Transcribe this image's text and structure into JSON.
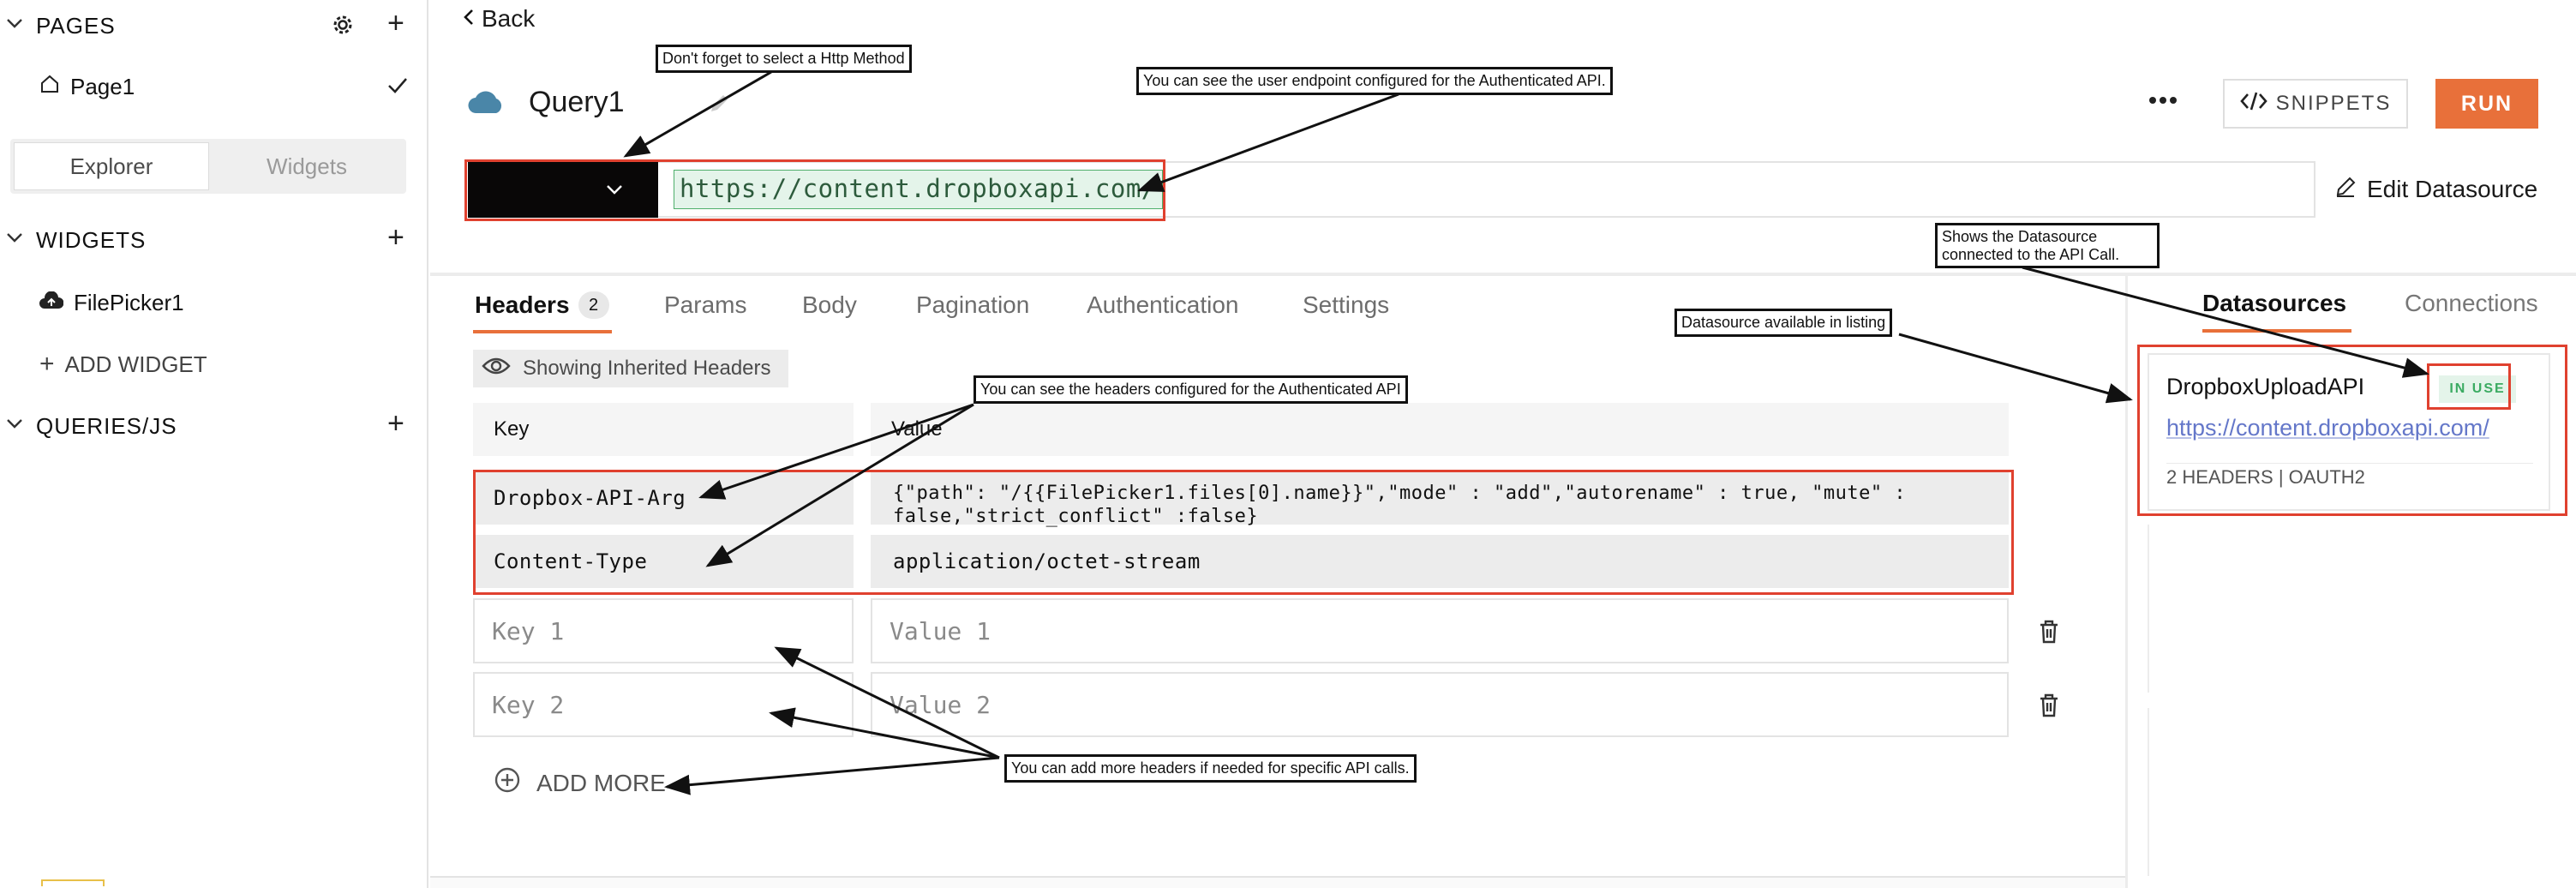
{
  "sidebar": {
    "pages_title": "PAGES",
    "page1": "Page1",
    "toggle_explorer": "Explorer",
    "toggle_widgets": "Widgets",
    "widgets_title": "WIDGETS",
    "widget_item": "FilePicker1",
    "add_widget": "ADD WIDGET",
    "queries_title": "QUERIES/JS"
  },
  "header": {
    "back": "Back",
    "query_name": "Query1",
    "snippets": "SNIPPETS",
    "run": "RUN",
    "edit_datasource": "Edit Datasource"
  },
  "url": {
    "value": "https://content.dropboxapi.com/"
  },
  "tabs": {
    "headers": "Headers",
    "headers_count": "2",
    "params": "Params",
    "body": "Body",
    "pagination": "Pagination",
    "authentication": "Authentication",
    "settings": "Settings"
  },
  "headers_panel": {
    "showing_inherited": "Showing Inherited Headers",
    "col_key": "Key",
    "col_value": "Value",
    "rows": [
      {
        "key": "Dropbox-API-Arg",
        "value": "{\"path\": \"/{{FilePicker1.files[0].name}}\",\"mode\" : \"add\",\"autorename\" : true, \"mute\" :",
        "value2": "false,\"strict_conflict\" :false}"
      },
      {
        "key": "Content-Type",
        "value": "application/octet-stream"
      }
    ],
    "placeholders": [
      {
        "key": "Key 1",
        "value": "Value 1"
      },
      {
        "key": "Key 2",
        "value": "Value 2"
      }
    ],
    "add_more": "ADD MORE"
  },
  "right_panel": {
    "tab_datasources": "Datasources",
    "tab_connections": "Connections",
    "ds_name": "DropboxUploadAPI",
    "ds_badge": "IN USE",
    "ds_url": "https://content.dropboxapi.com/",
    "ds_meta": "2 HEADERS | OAUTH2"
  },
  "annotations": {
    "http_method": "Don't forget to select a Http Method",
    "endpoint": "You can see the user endpoint configured for the Authenticated API.",
    "datasource_connected_1": "Shows the Datasource",
    "datasource_connected_2": "connected to the API Call.",
    "datasource_listing": "Datasource available in listing",
    "headers_configured": "You can see the headers configured for the Authenticated API",
    "add_more_headers": "You can add more headers if needed for specific API calls."
  },
  "colors": {
    "run_button": "#e8703a",
    "annotation_red": "#e0412f",
    "active_tab_underline": "#e8703a",
    "link_blue": "#6477c9",
    "badge_green": "#e4f4ea"
  }
}
